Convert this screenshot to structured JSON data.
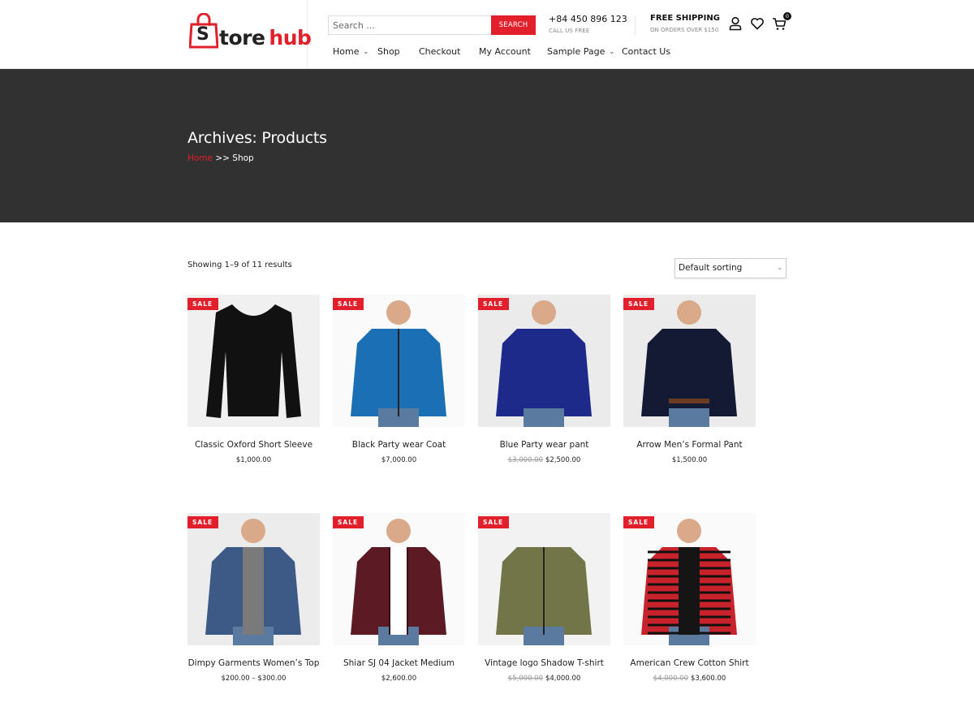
{
  "brand": {
    "name_dark": "tore",
    "name_red": "hub",
    "bag_letter": "S",
    "accent": "#e2202b"
  },
  "search": {
    "placeholder": "Search ...",
    "button_label": "SEARCH"
  },
  "contact": {
    "phone": "+84 450 896 123",
    "phone_sub": "CALL US FREE"
  },
  "shipping": {
    "title": "FREE SHIPPING",
    "sub": "ON ORDERS OVER $150"
  },
  "header_icons": [
    "user-icon",
    "heart-icon",
    "cart-icon"
  ],
  "cart_count": "0",
  "nav": [
    {
      "label": "Home",
      "dropdown": true
    },
    {
      "label": "Shop",
      "dropdown": false
    },
    {
      "label": "Checkout",
      "dropdown": false
    },
    {
      "label": "My Account",
      "dropdown": false
    },
    {
      "label": "Sample Page",
      "dropdown": true
    },
    {
      "label": "Contact Us",
      "dropdown": false
    }
  ],
  "banner": {
    "title": "Archives: Products",
    "breadcrumb_home": "Home",
    "breadcrumb_sep": " >> ",
    "breadcrumb_current": "Shop"
  },
  "shop": {
    "result_count": "Showing 1–9 of 11 results",
    "sorting_selected": "Default sorting"
  },
  "sale_label": "SALE",
  "products": [
    {
      "name": "Classic Oxford Short Sleeve",
      "old_price": "",
      "price": "$1,000.00",
      "sale": true
    },
    {
      "name": "Black Party wear Coat",
      "old_price": "",
      "price": "$7,000.00",
      "sale": true
    },
    {
      "name": "Blue Party wear pant",
      "old_price": "$3,000.00",
      "price": "$2,500.00",
      "sale": true
    },
    {
      "name": "Arrow Men’s Formal Pant",
      "old_price": "",
      "price": "$1,500.00",
      "sale": true
    },
    {
      "name": "Dimpy Garments Women’s Top",
      "old_price": "",
      "price": "$200.00 – $300.00",
      "sale": true
    },
    {
      "name": "Shiar SJ 04 Jacket Medium",
      "old_price": "",
      "price": "$2,600.00",
      "sale": true
    },
    {
      "name": "Vintage logo Shadow T-shirt",
      "old_price": "$5,000.00",
      "price": "$4,000.00",
      "sale": true
    },
    {
      "name": "American Crew Cotton Shirt",
      "old_price": "$4,000.00",
      "price": "$3,600.00",
      "sale": true
    }
  ]
}
